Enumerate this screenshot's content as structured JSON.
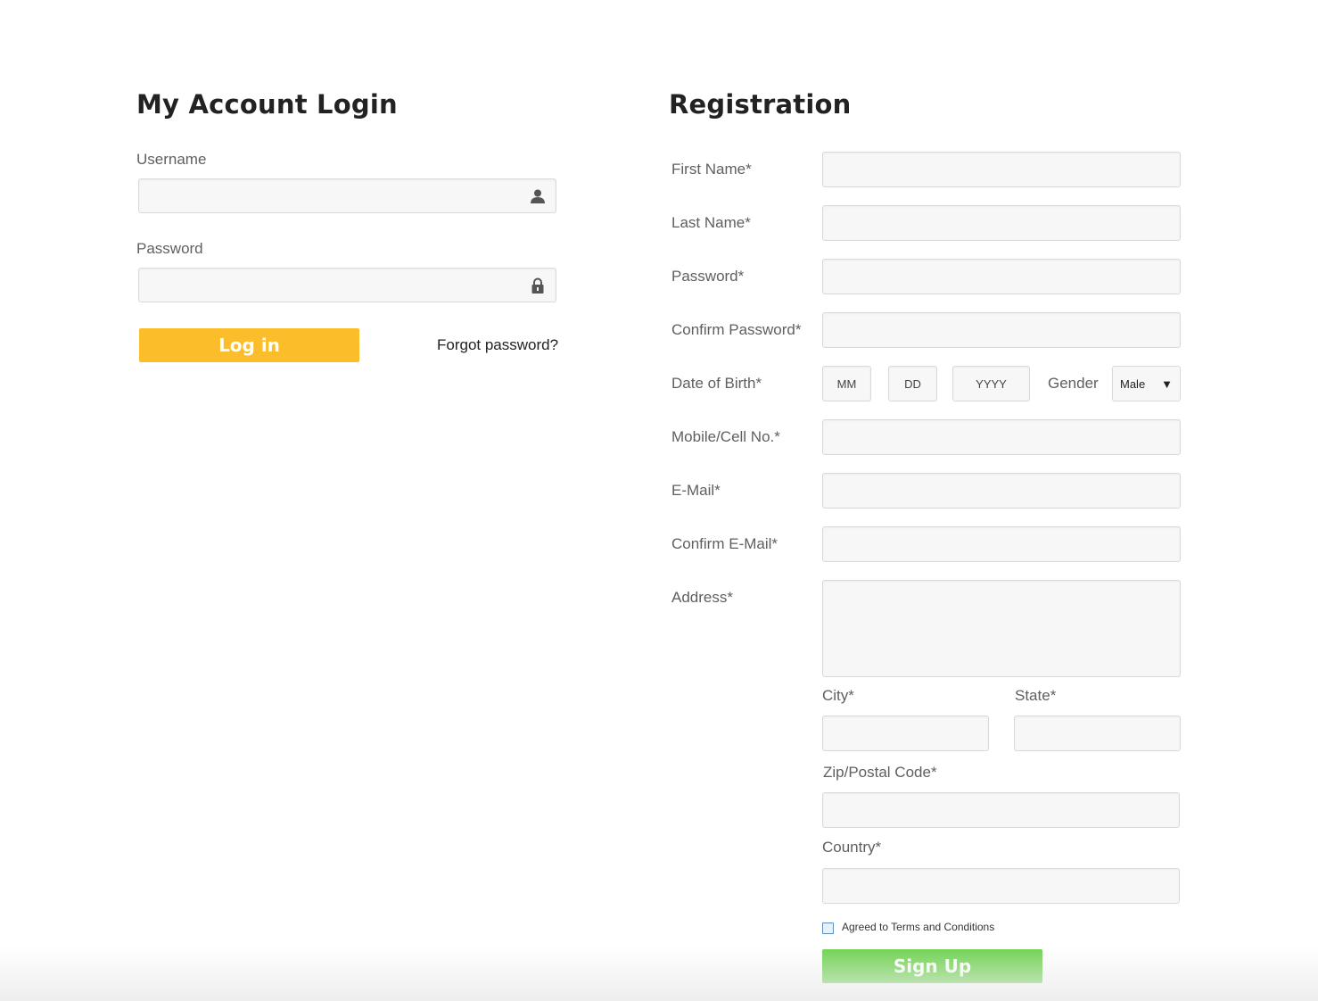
{
  "login": {
    "title": "My Account Login",
    "username_label": "Username",
    "username_value": "",
    "password_label": "Password",
    "password_value": "",
    "login_button": "Log in",
    "forgot_link": "Forgot password?",
    "username_icon": "user-icon",
    "password_icon": "lock-icon"
  },
  "registration": {
    "title": "Registration",
    "first_name_label": "First Name*",
    "last_name_label": "Last Name*",
    "password_label": "Password*",
    "confirm_password_label": "Confirm Password*",
    "dob_label": "Date of Birth*",
    "dob_month_placeholder": "MM",
    "dob_day_placeholder": "DD",
    "dob_year_placeholder": "YYYY",
    "gender_label": "Gender",
    "gender_selected": "Male",
    "mobile_label": "Mobile/Cell No.*",
    "email_label": "E-Mail*",
    "confirm_email_label": "Confirm E-Mail*",
    "address_label": "Address*",
    "city_label": "City*",
    "state_label": "State*",
    "zip_label": "Zip/Postal Code*",
    "country_label": "Country*",
    "terms_label": "Agreed to Terms and Conditions",
    "terms_checked": false,
    "signup_button": "Sign Up"
  },
  "colors": {
    "login_button": "#fbbd2a",
    "signup_button": "#6dd24e",
    "field_background": "#f7f7f7",
    "field_border": "#d9d9d9"
  }
}
